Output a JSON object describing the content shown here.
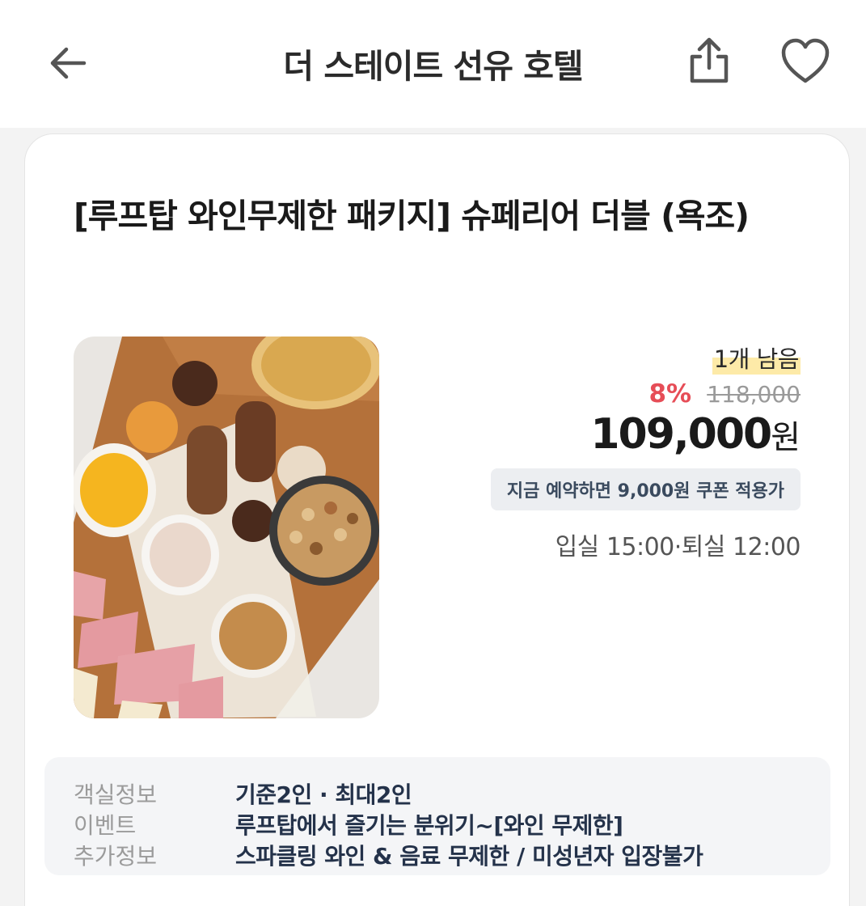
{
  "header": {
    "title": "더 스테이트 선유 호텔",
    "back_icon": "arrow-left-icon",
    "share_icon": "share-icon",
    "like_icon": "heart-icon"
  },
  "room": {
    "title": "[루프탑 와인무제한 패키지] 슈페리어 더블 (욕조)",
    "remaining": "1개 남음",
    "discount_rate": "8%",
    "original_price": "118,000",
    "final_price": "109,000",
    "currency_unit": "원",
    "coupon_text": "지금 예약하면 9,000원 쿠폰 적용가",
    "checkin_checkout": "입실 15:00·퇴실 12:00"
  },
  "info": [
    {
      "label": "객실정보",
      "value": "기준2인 · 최대2인"
    },
    {
      "label": "이벤트",
      "value": "루프탑에서 즐기는 분위기~[와인 무제한]"
    },
    {
      "label": "추가정보",
      "value": "스파클링 와인 & 음료 무제한 / 미성년자 입장불가"
    }
  ],
  "colors": {
    "discount": "#e64d57",
    "highlight": "#fdeaa8",
    "info_value": "#24324a",
    "coupon_bg": "#eceef1"
  }
}
